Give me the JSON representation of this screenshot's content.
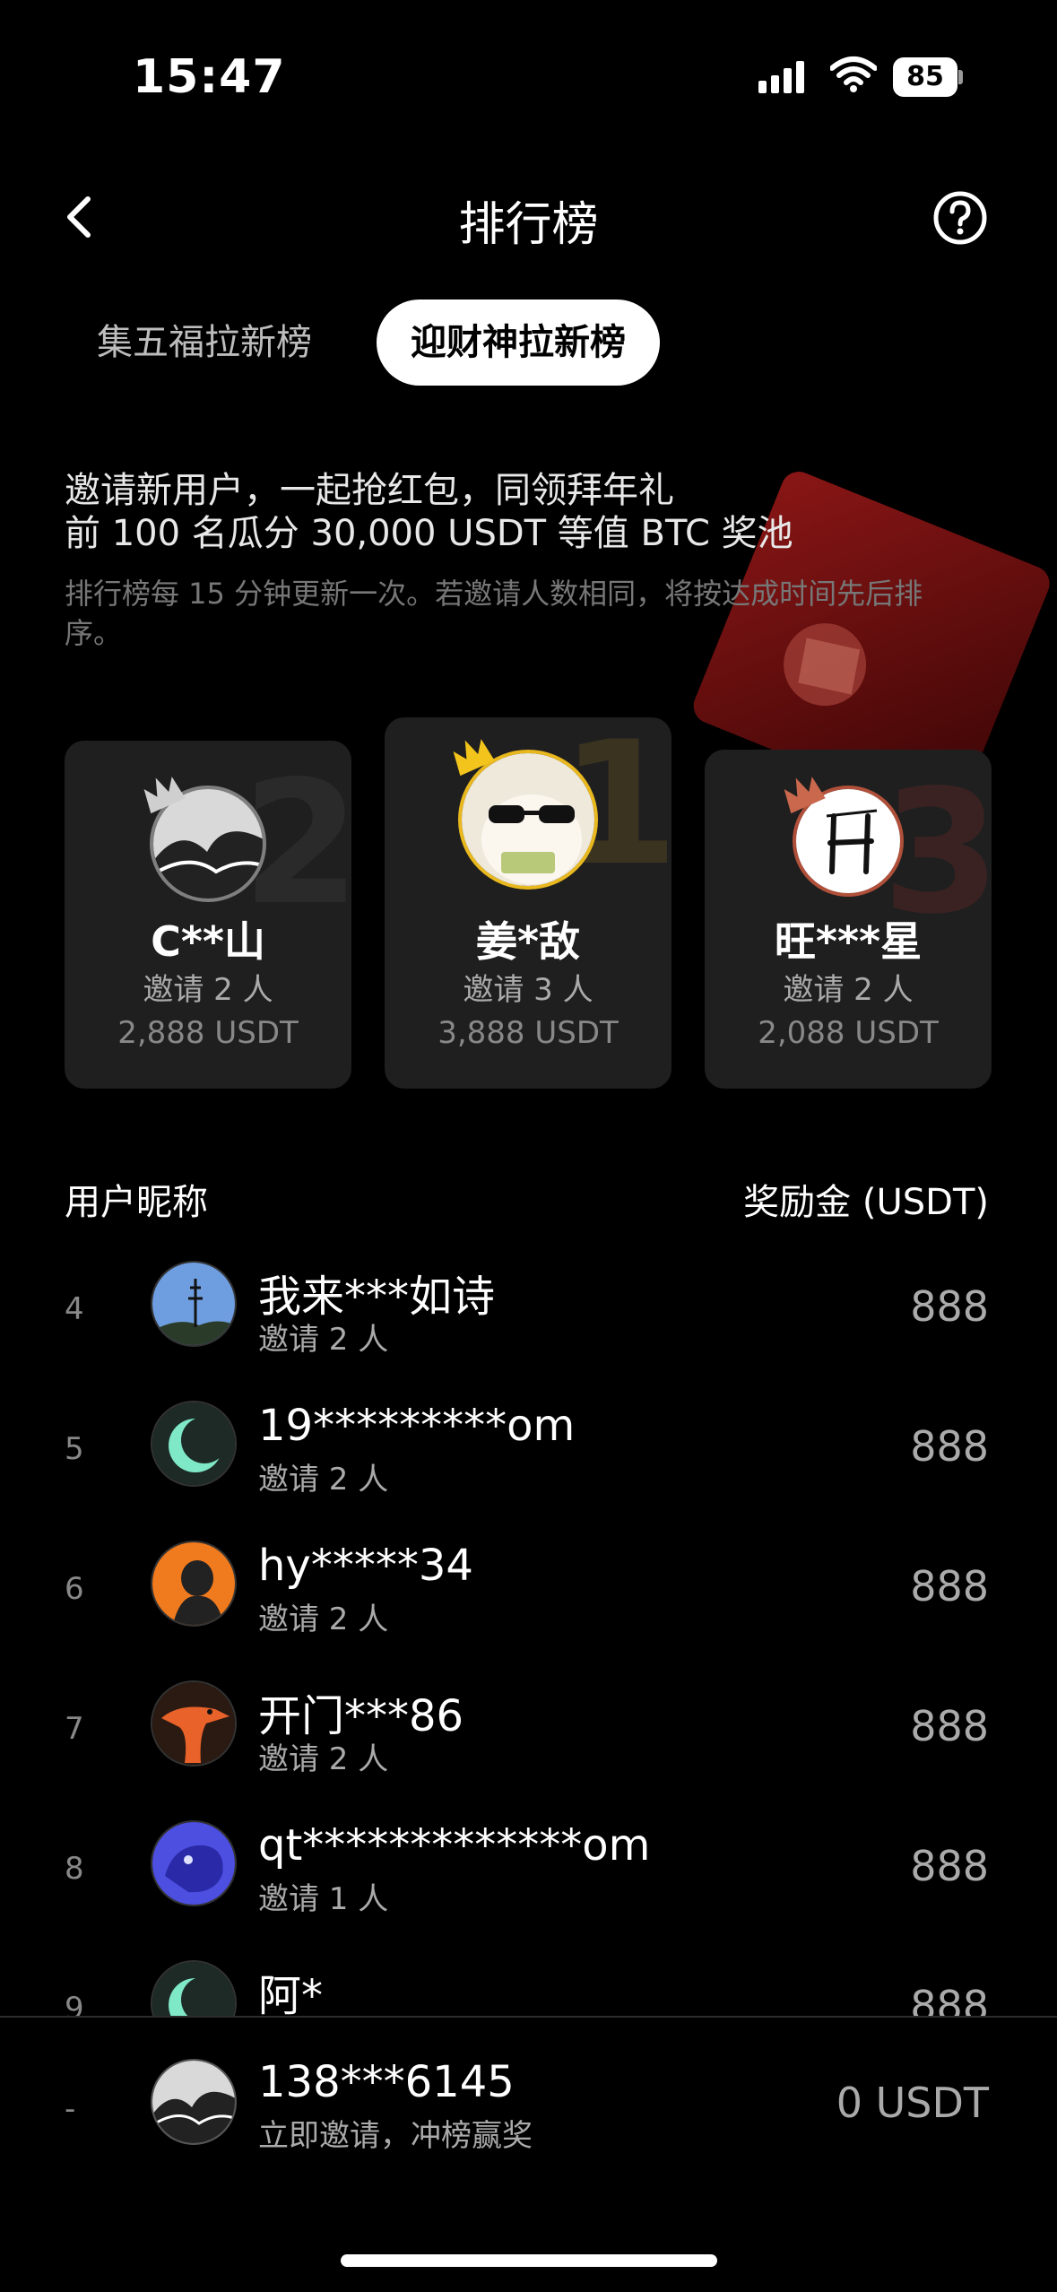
{
  "status_bar": {
    "time": "15:47",
    "battery": "85"
  },
  "header": {
    "title": "排行榜",
    "back_icon": "chevron-left-icon",
    "help_icon": "question-circle-icon"
  },
  "tabs": [
    {
      "label": "集五福拉新榜",
      "active": false
    },
    {
      "label": "迎财神拉新榜",
      "active": true
    }
  ],
  "intro": {
    "line1": "邀请新用户，一起抢红包，同领拜年礼",
    "line2": "前 100 名瓜分 30,000 USDT 等值 BTC 奖池",
    "note": "排行榜每 15 分钟更新一次。若邀请人数相同，将按达成时间先后排序。"
  },
  "podium": [
    {
      "rank": "2",
      "name": "C**山",
      "invite": "邀请 2 人",
      "reward": "2,888 USDT"
    },
    {
      "rank": "1",
      "name": "姜*敌",
      "invite": "邀请 3 人",
      "reward": "3,888 USDT"
    },
    {
      "rank": "3",
      "name": "旺***星",
      "invite": "邀请 2 人",
      "reward": "2,088 USDT"
    }
  ],
  "list_header": {
    "left": "用户昵称",
    "right": "奖励金 (USDT)"
  },
  "rows": [
    {
      "rank": "4",
      "name": "我来***如诗",
      "invite": "邀请 2 人",
      "amount": "888"
    },
    {
      "rank": "5",
      "name": "19*********om",
      "invite": "邀请 2 人",
      "amount": "888"
    },
    {
      "rank": "6",
      "name": "hy*****34",
      "invite": "邀请 2 人",
      "amount": "888"
    },
    {
      "rank": "7",
      "name": "开门***86",
      "invite": "邀请 2 人",
      "amount": "888"
    },
    {
      "rank": "8",
      "name": "qt*************om",
      "invite": "邀请 1 人",
      "amount": "888"
    },
    {
      "rank": "9",
      "name": "阿*",
      "invite": "",
      "amount": "888"
    }
  ],
  "me": {
    "rank": "-",
    "name": "138***6145",
    "sub": "立即邀请，冲榜赢奖",
    "amount": "0 USDT"
  },
  "colors": {
    "gold": "#e8b81e",
    "silver": "#7f7f7f",
    "bronze": "#b0503a",
    "envelope_red": "#7a1414"
  }
}
